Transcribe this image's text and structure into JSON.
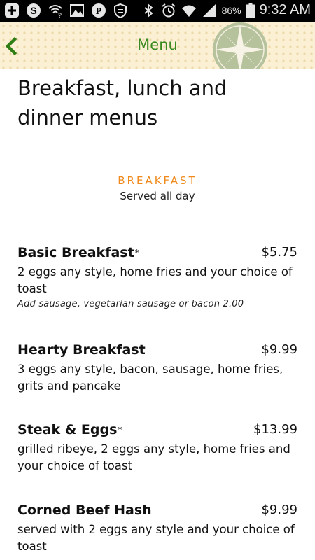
{
  "status_bar": {
    "left_icons": [
      "add-icon",
      "skype-icon",
      "wifi-question-icon",
      "image-icon",
      "pinterest-icon",
      "shield-icon"
    ],
    "right_icons": [
      "bluetooth-icon",
      "alarm-icon",
      "wifi-icon",
      "signal-icon"
    ],
    "battery": "86%",
    "time": "9:32 AM"
  },
  "header": {
    "title": "Menu",
    "back_icon": "chevron-left-icon",
    "logo": "compass-rose",
    "accent_color": "#3a8a1f"
  },
  "page": {
    "title": "Breakfast, lunch and dinner menus"
  },
  "section": {
    "heading": "BREAKFAST",
    "subheading": "Served all day",
    "heading_color": "#f08a1c"
  },
  "items": [
    {
      "name": "Basic Breakfast",
      "marker": "*",
      "price": "$5.75",
      "description": "2 eggs any style, home fries and your choice of toast",
      "note": "Add sausage, vegetarian sausage or bacon 2.00"
    },
    {
      "name": "Hearty Breakfast",
      "marker": "",
      "price": "$9.99",
      "description": "3 eggs any style, bacon, sausage, home fries, grits and pancake",
      "note": ""
    },
    {
      "name": "Steak & Eggs",
      "marker": "*",
      "price": "$13.99",
      "description": "grilled ribeye, 2 eggs any style, home fries and your choice of toast",
      "note": ""
    },
    {
      "name": "Corned Beef Hash",
      "marker": "",
      "price": "$9.99",
      "description": "served with 2 eggs any style and your choice of toast",
      "note": ""
    }
  ]
}
